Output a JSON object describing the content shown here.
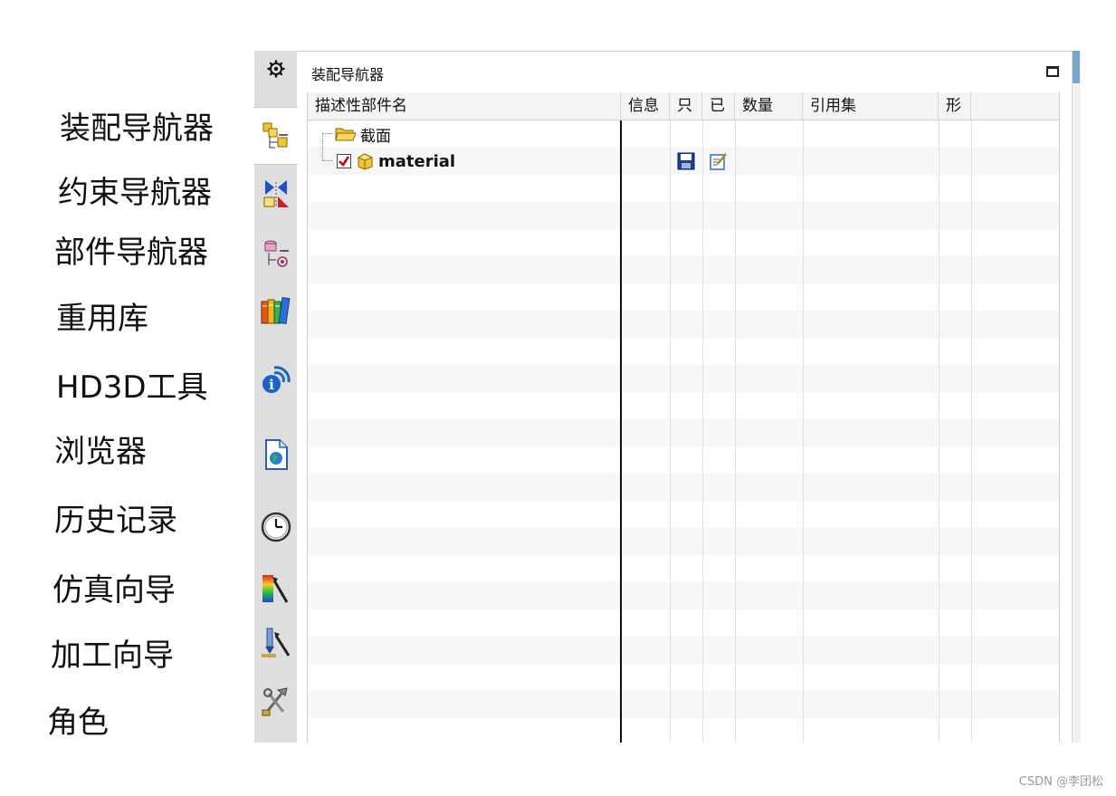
{
  "annotations": [
    "装配导航器",
    "约束导航器",
    "部件导航器",
    "重用库",
    "HD3D工具",
    "浏览器",
    "历史记录",
    "仿真向导",
    "加工向导",
    "角色"
  ],
  "resource_bar": {
    "top_icon": "gear-icon",
    "tabs": [
      {
        "icon": "assembly-navigator-icon",
        "active": true
      },
      {
        "icon": "constraint-navigator-icon",
        "active": false
      },
      {
        "icon": "part-navigator-icon",
        "active": false
      },
      {
        "icon": "reuse-library-icon",
        "active": false
      },
      {
        "icon": "hd3d-tools-icon",
        "active": false
      },
      {
        "icon": "web-browser-icon",
        "active": false
      },
      {
        "icon": "history-icon",
        "active": false
      },
      {
        "icon": "simulation-wizard-icon",
        "active": false
      },
      {
        "icon": "manufacturing-wizard-icon",
        "active": false
      },
      {
        "icon": "roles-icon",
        "active": false
      }
    ]
  },
  "panel": {
    "title": "装配导航器",
    "maximize_icon": "maximize-icon"
  },
  "table": {
    "columns": [
      "描述性部件名",
      "信息",
      "只",
      "已",
      "数量",
      "引用集",
      "形"
    ],
    "rows": [
      {
        "name": "截面",
        "icon": "folder-icon",
        "checked": null
      },
      {
        "name": "material",
        "icon": "part-cube-icon",
        "checked": true,
        "readonly_icon": "save-disk-icon",
        "modified_icon": "edit-note-icon"
      }
    ]
  },
  "watermark": "CSDN @李团松",
  "colors": {
    "accent": "#7aa7c9",
    "check_red": "#d00000",
    "folder_yellow": "#f1c232"
  }
}
